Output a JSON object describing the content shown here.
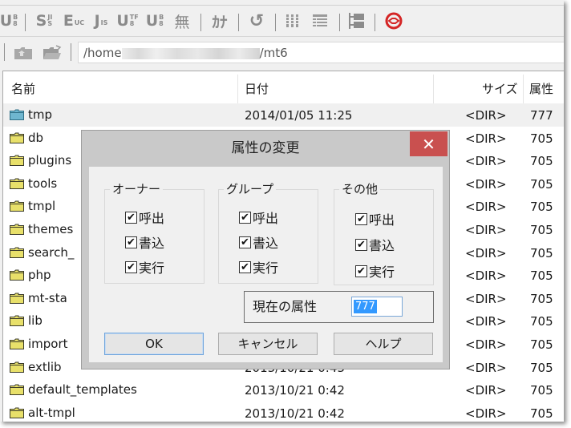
{
  "toolbar": {
    "buttons": [
      {
        "name": "utf8-bom-button",
        "label": "U",
        "sup": "B",
        "sub": "8"
      },
      {
        "name": "sjis-button",
        "label": "S",
        "sup": "JI",
        "sub": "S"
      },
      {
        "name": "euc-button",
        "label": "E",
        "sup": "",
        "sub": "UC"
      },
      {
        "name": "jis-button",
        "label": "J",
        "sup": "",
        "sub": "IS"
      },
      {
        "name": "utf8-button",
        "label": "U",
        "sup": "TF",
        "sub": "8"
      },
      {
        "name": "utf8-bom2-button",
        "label": "U",
        "sup": "B",
        "sub": "8"
      },
      {
        "name": "no-conversion-button",
        "label": "無"
      },
      {
        "name": "kana-button",
        "label": "ｶﾅ"
      },
      {
        "name": "refresh-button",
        "label": "↺"
      },
      {
        "name": "list-view-button",
        "label": ""
      },
      {
        "name": "detail-view-button",
        "label": ""
      },
      {
        "name": "tree-view-button",
        "label": ""
      },
      {
        "name": "disconnect-button",
        "label": ""
      }
    ]
  },
  "address": {
    "path_prefix": "/home",
    "path_suffix": "/mt6"
  },
  "list": {
    "columns": [
      "名前",
      "日付",
      "サイズ",
      "属性"
    ],
    "rows": [
      {
        "name": "tmp",
        "date": "2014/01/05 11:25",
        "size": "<DIR>",
        "attr": "777",
        "selected": true
      },
      {
        "name": "db",
        "date": "",
        "size": "<DIR>",
        "attr": "705"
      },
      {
        "name": "plugins",
        "date": "",
        "size": "<DIR>",
        "attr": "705"
      },
      {
        "name": "tools",
        "date": "",
        "size": "<DIR>",
        "attr": "705"
      },
      {
        "name": "tmpl",
        "date": "",
        "size": "<DIR>",
        "attr": "705"
      },
      {
        "name": "themes",
        "date": "",
        "size": "<DIR>",
        "attr": "705"
      },
      {
        "name": "search_",
        "date": "",
        "size": "<DIR>",
        "attr": "705"
      },
      {
        "name": "php",
        "date": "",
        "size": "<DIR>",
        "attr": "705"
      },
      {
        "name": "mt-sta",
        "date": "",
        "size": "<DIR>",
        "attr": "705"
      },
      {
        "name": "lib",
        "date": "",
        "size": "<DIR>",
        "attr": "705"
      },
      {
        "name": "import",
        "date": "",
        "size": "<DIR>",
        "attr": "705"
      },
      {
        "name": "extlib",
        "date": "2013/10/21 0:43",
        "size": "<DIR>",
        "attr": "705"
      },
      {
        "name": "default_templates",
        "date": "2013/10/21  0:42",
        "size": "<DIR>",
        "attr": "705"
      },
      {
        "name": "alt-tmpl",
        "date": "2013/10/21  0:42",
        "size": "<DIR>",
        "attr": "705"
      }
    ]
  },
  "dialog": {
    "title": "属性の変更",
    "close_label": "✕",
    "groups": [
      {
        "legend": "オーナー",
        "items": [
          {
            "label": "呼出",
            "checked": true
          },
          {
            "label": "書込",
            "checked": true
          },
          {
            "label": "実行",
            "checked": true
          }
        ]
      },
      {
        "legend": "グループ",
        "items": [
          {
            "label": "呼出",
            "checked": true
          },
          {
            "label": "書込",
            "checked": true
          },
          {
            "label": "実行",
            "checked": true
          }
        ]
      },
      {
        "legend": "その他",
        "items": [
          {
            "label": "呼出",
            "checked": true
          },
          {
            "label": "書込",
            "checked": true
          },
          {
            "label": "実行",
            "checked": true
          }
        ]
      }
    ],
    "current_attr_label": "現在の属性",
    "current_attr_value": "777",
    "ok_label": "OK",
    "cancel_label": "キャンセル",
    "help_label": "ヘルプ",
    "check_glyph": "✔"
  },
  "colors": {
    "close_button": "#c9504f",
    "selection": "#3399ff",
    "folder_yellow": "#e8e06a",
    "folder_teal": "#6fb6cf"
  }
}
